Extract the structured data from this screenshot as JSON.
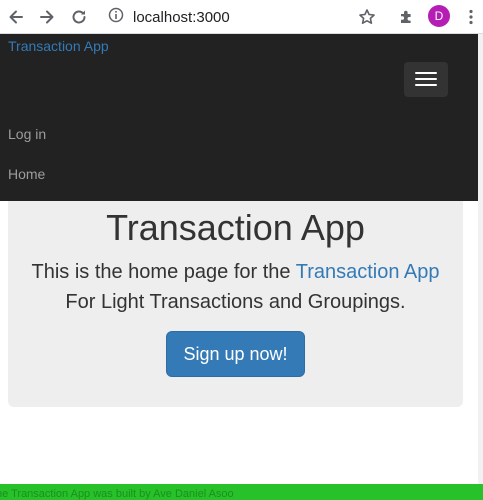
{
  "browser": {
    "url": "localhost:3000",
    "profile_initial": "D",
    "icons": [
      "back-arrow-icon",
      "forward-arrow-icon",
      "reload-icon",
      "info-icon",
      "star-icon",
      "extensions-puzzle-icon",
      "kebab-menu-icon"
    ]
  },
  "navbar": {
    "brand": "Transaction App",
    "links": [
      "Log in",
      "Home"
    ],
    "colors": {
      "background": "#222222",
      "brand": "#337ab7",
      "link": "#9d9d9d"
    }
  },
  "jumbotron": {
    "title": "Transaction App",
    "lead_before": "This is the home page for the ",
    "lead_link": "Transaction App",
    "lead_after": " For Light Transactions and Groupings.",
    "button": "Sign up now!"
  },
  "footer": {
    "text": "he Transaction App was built by Ave Daniel Asoo",
    "background": "#27c12a"
  }
}
